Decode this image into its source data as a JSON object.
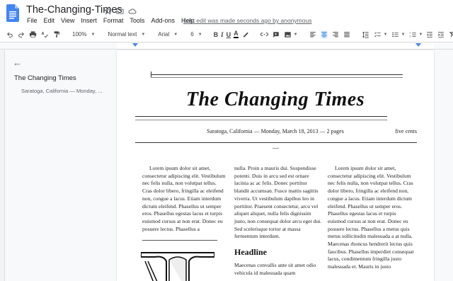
{
  "app": {
    "title": "The-Changing-Times",
    "last_edit": "Last edit was made seconds ago by anonymous",
    "menu": [
      "File",
      "Edit",
      "View",
      "Insert",
      "Format",
      "Tools",
      "Add-ons",
      "Help"
    ]
  },
  "toolbar": {
    "zoom": "100%",
    "style": "Normal text",
    "font": "Arial",
    "size": "6"
  },
  "outline": {
    "heading": "The Changing Times",
    "subheading": "Saratoga, California — Monday, ..."
  },
  "document": {
    "masthead": "The Changing Times",
    "dateline": "Saratoga, California — Monday, March 18, 2013 — 2 pages",
    "price": "five cents",
    "dash": "—",
    "col1": "Lorem ipsum dolor sit amet, consectetur adipiscing elit. Vestibulum nec felis nulla, non volutpat tellus. Cras dolor libero, fringilla ac eleifend non, congue a lacus. Etiam interdum dictum eleifend. Phasellus ut semper eros. Phasellus egestas lacus et turpis euismod cursus at non erat. Donec eu posuere lectus. Phasellus a",
    "col2": "nulla. Proin a mauris dui. Suspendisse potenti. Duis in arcu sed est ornare lacinia ac ac felis. Donec porttitor blandit accumsan. Fusce mattis sagittis viverra. Ut vestibulum dapibus leo in porttitor. Praesent consectetur, arcu vel aliquet aliquet, nulla felis dignissim justo, non consequat dolor arcu eget dui. Sed scelerisque tortor at massa fermentum interdum.",
    "headline": "Headline",
    "col2b": "Maecenas convallis ante sit amet odio vehicula id malesuada quam",
    "col3": "Lorem ipsum dolor sit amet, consectetur adipiscing elit. Vestibulum nec felis nulla, non volutpat tellus. Cras dolor libero, fringilla ac eleifend non, congue a lacus. Etiam interdum dictum eleifend. Phasellus ut semper eros. Phasellus egestas lacus et turpis euismod cursus at non erat. Donec eu posuere lectus. Phasellus a metus quis metus sollicitudin malesuada a at nulla. Maecenas rhoncus hendrerit lectus quis faucibus. Phasellus imperdiet consequat lacus, condimentum fringilla justo malesuada et. Mauris in justo"
  },
  "colors": {
    "accent": "#1a73e8",
    "doc_icon": "#4285f4",
    "page_bg": "#ffffff",
    "app_bg": "#f8f9fa"
  }
}
